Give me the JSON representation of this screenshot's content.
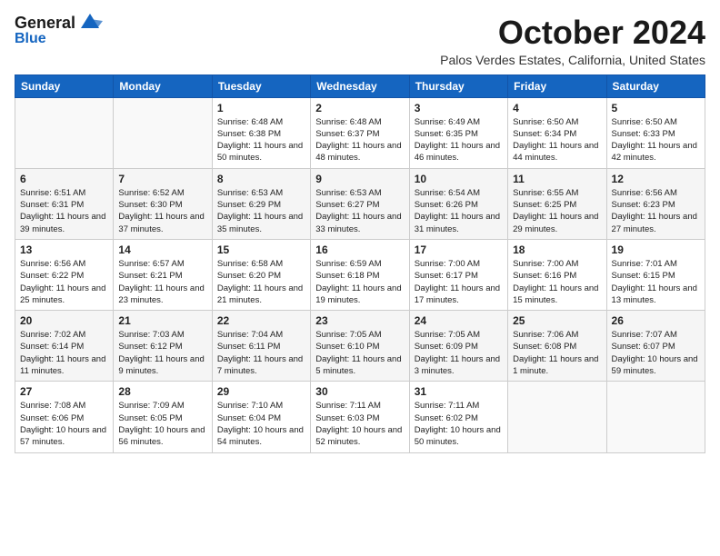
{
  "logo": {
    "line1": "General",
    "line2": "Blue"
  },
  "title": "October 2024",
  "location": "Palos Verdes Estates, California, United States",
  "days_of_week": [
    "Sunday",
    "Monday",
    "Tuesday",
    "Wednesday",
    "Thursday",
    "Friday",
    "Saturday"
  ],
  "weeks": [
    [
      {
        "day": "",
        "info": ""
      },
      {
        "day": "",
        "info": ""
      },
      {
        "day": "1",
        "info": "Sunrise: 6:48 AM\nSunset: 6:38 PM\nDaylight: 11 hours and 50 minutes."
      },
      {
        "day": "2",
        "info": "Sunrise: 6:48 AM\nSunset: 6:37 PM\nDaylight: 11 hours and 48 minutes."
      },
      {
        "day": "3",
        "info": "Sunrise: 6:49 AM\nSunset: 6:35 PM\nDaylight: 11 hours and 46 minutes."
      },
      {
        "day": "4",
        "info": "Sunrise: 6:50 AM\nSunset: 6:34 PM\nDaylight: 11 hours and 44 minutes."
      },
      {
        "day": "5",
        "info": "Sunrise: 6:50 AM\nSunset: 6:33 PM\nDaylight: 11 hours and 42 minutes."
      }
    ],
    [
      {
        "day": "6",
        "info": "Sunrise: 6:51 AM\nSunset: 6:31 PM\nDaylight: 11 hours and 39 minutes."
      },
      {
        "day": "7",
        "info": "Sunrise: 6:52 AM\nSunset: 6:30 PM\nDaylight: 11 hours and 37 minutes."
      },
      {
        "day": "8",
        "info": "Sunrise: 6:53 AM\nSunset: 6:29 PM\nDaylight: 11 hours and 35 minutes."
      },
      {
        "day": "9",
        "info": "Sunrise: 6:53 AM\nSunset: 6:27 PM\nDaylight: 11 hours and 33 minutes."
      },
      {
        "day": "10",
        "info": "Sunrise: 6:54 AM\nSunset: 6:26 PM\nDaylight: 11 hours and 31 minutes."
      },
      {
        "day": "11",
        "info": "Sunrise: 6:55 AM\nSunset: 6:25 PM\nDaylight: 11 hours and 29 minutes."
      },
      {
        "day": "12",
        "info": "Sunrise: 6:56 AM\nSunset: 6:23 PM\nDaylight: 11 hours and 27 minutes."
      }
    ],
    [
      {
        "day": "13",
        "info": "Sunrise: 6:56 AM\nSunset: 6:22 PM\nDaylight: 11 hours and 25 minutes."
      },
      {
        "day": "14",
        "info": "Sunrise: 6:57 AM\nSunset: 6:21 PM\nDaylight: 11 hours and 23 minutes."
      },
      {
        "day": "15",
        "info": "Sunrise: 6:58 AM\nSunset: 6:20 PM\nDaylight: 11 hours and 21 minutes."
      },
      {
        "day": "16",
        "info": "Sunrise: 6:59 AM\nSunset: 6:18 PM\nDaylight: 11 hours and 19 minutes."
      },
      {
        "day": "17",
        "info": "Sunrise: 7:00 AM\nSunset: 6:17 PM\nDaylight: 11 hours and 17 minutes."
      },
      {
        "day": "18",
        "info": "Sunrise: 7:00 AM\nSunset: 6:16 PM\nDaylight: 11 hours and 15 minutes."
      },
      {
        "day": "19",
        "info": "Sunrise: 7:01 AM\nSunset: 6:15 PM\nDaylight: 11 hours and 13 minutes."
      }
    ],
    [
      {
        "day": "20",
        "info": "Sunrise: 7:02 AM\nSunset: 6:14 PM\nDaylight: 11 hours and 11 minutes."
      },
      {
        "day": "21",
        "info": "Sunrise: 7:03 AM\nSunset: 6:12 PM\nDaylight: 11 hours and 9 minutes."
      },
      {
        "day": "22",
        "info": "Sunrise: 7:04 AM\nSunset: 6:11 PM\nDaylight: 11 hours and 7 minutes."
      },
      {
        "day": "23",
        "info": "Sunrise: 7:05 AM\nSunset: 6:10 PM\nDaylight: 11 hours and 5 minutes."
      },
      {
        "day": "24",
        "info": "Sunrise: 7:05 AM\nSunset: 6:09 PM\nDaylight: 11 hours and 3 minutes."
      },
      {
        "day": "25",
        "info": "Sunrise: 7:06 AM\nSunset: 6:08 PM\nDaylight: 11 hours and 1 minute."
      },
      {
        "day": "26",
        "info": "Sunrise: 7:07 AM\nSunset: 6:07 PM\nDaylight: 10 hours and 59 minutes."
      }
    ],
    [
      {
        "day": "27",
        "info": "Sunrise: 7:08 AM\nSunset: 6:06 PM\nDaylight: 10 hours and 57 minutes."
      },
      {
        "day": "28",
        "info": "Sunrise: 7:09 AM\nSunset: 6:05 PM\nDaylight: 10 hours and 56 minutes."
      },
      {
        "day": "29",
        "info": "Sunrise: 7:10 AM\nSunset: 6:04 PM\nDaylight: 10 hours and 54 minutes."
      },
      {
        "day": "30",
        "info": "Sunrise: 7:11 AM\nSunset: 6:03 PM\nDaylight: 10 hours and 52 minutes."
      },
      {
        "day": "31",
        "info": "Sunrise: 7:11 AM\nSunset: 6:02 PM\nDaylight: 10 hours and 50 minutes."
      },
      {
        "day": "",
        "info": ""
      },
      {
        "day": "",
        "info": ""
      }
    ]
  ]
}
